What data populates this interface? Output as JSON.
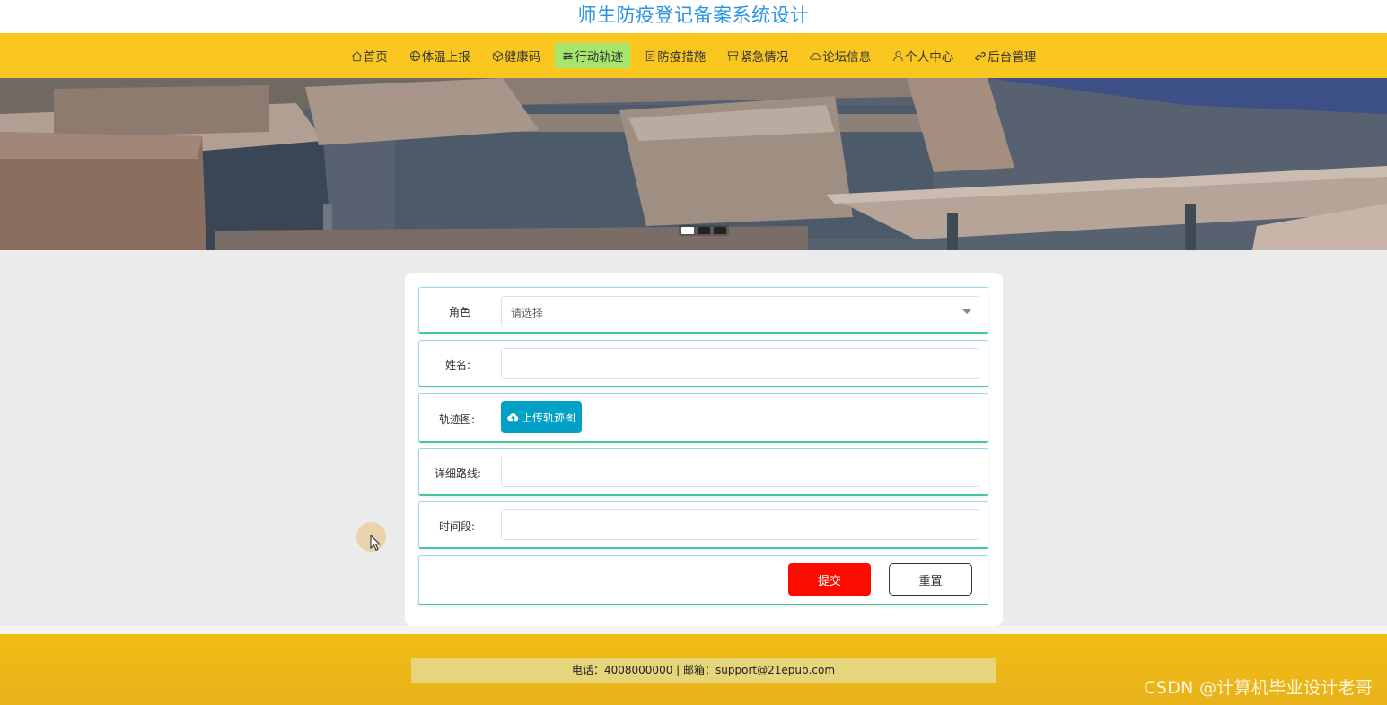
{
  "site": {
    "title": "师生防疫登记备案系统设计"
  },
  "nav": {
    "items": [
      {
        "label": "首页",
        "icon": "home-icon"
      },
      {
        "label": "体温上报",
        "icon": "globe-icon"
      },
      {
        "label": "健康码",
        "icon": "cube-icon"
      },
      {
        "label": "行动轨迹",
        "icon": "sliders-icon"
      },
      {
        "label": "防疫措施",
        "icon": "document-icon"
      },
      {
        "label": "紧急情况",
        "icon": "grid-icon"
      },
      {
        "label": "论坛信息",
        "icon": "cloud-icon"
      },
      {
        "label": "个人中心",
        "icon": "user-icon"
      },
      {
        "label": "后台管理",
        "icon": "link-icon"
      }
    ],
    "active": "行动轨迹"
  },
  "carousel": {
    "slide_count": 3,
    "active_slide": 1
  },
  "form": {
    "role": {
      "label": "角色",
      "placeholder": "请选择"
    },
    "name": {
      "label": "姓名:",
      "value": ""
    },
    "track_image": {
      "label": "轨迹图:",
      "upload_label": "上传轨迹图"
    },
    "route_detail": {
      "label": "详细路线:",
      "value": ""
    },
    "time_period": {
      "label": "时间段:",
      "value": ""
    },
    "submit_label": "提交",
    "reset_label": "重置"
  },
  "footer": {
    "contact": "电话：4008000000 | 邮箱：support@21epub.com"
  },
  "watermark": "CSDN @计算机毕业设计老哥",
  "colors": {
    "title": "#2b95e0",
    "navbar": "#f9c720",
    "nav_active": "#a6e66b",
    "row_border_bottom": "#45c79b",
    "upload_button": "#00a0c7",
    "submit_button": "#fb0b00",
    "footer": "#f1bd14"
  }
}
